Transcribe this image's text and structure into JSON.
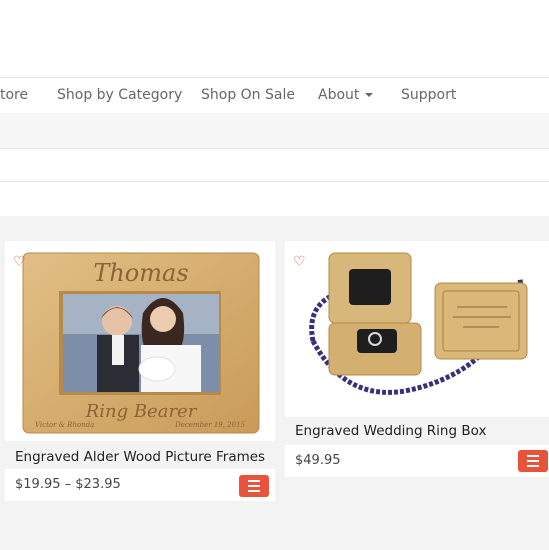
{
  "nav": {
    "items": [
      {
        "label": "tore"
      },
      {
        "label": "Shop by Category"
      },
      {
        "label": "Shop On Sale"
      },
      {
        "label": "About"
      },
      {
        "label": "Support"
      }
    ]
  },
  "products": [
    {
      "title": "Engraved Alder Wood Picture Frames",
      "price": "$19.95 – $23.95",
      "frame_text_top": "Thomas",
      "frame_text_bottom": "Ring Bearer",
      "frame_text_left": "Victor & Rhonda",
      "frame_text_right": "December 19, 2015"
    },
    {
      "title": "Engraved Wedding Ring Box",
      "price": "$49.95"
    }
  ],
  "colors": {
    "accent": "#e8533b",
    "wood": "#d8b173",
    "wood_dark": "#b58a4a"
  },
  "icons": {
    "wishlist": "heart-outline-icon",
    "menu": "hamburger-icon"
  }
}
